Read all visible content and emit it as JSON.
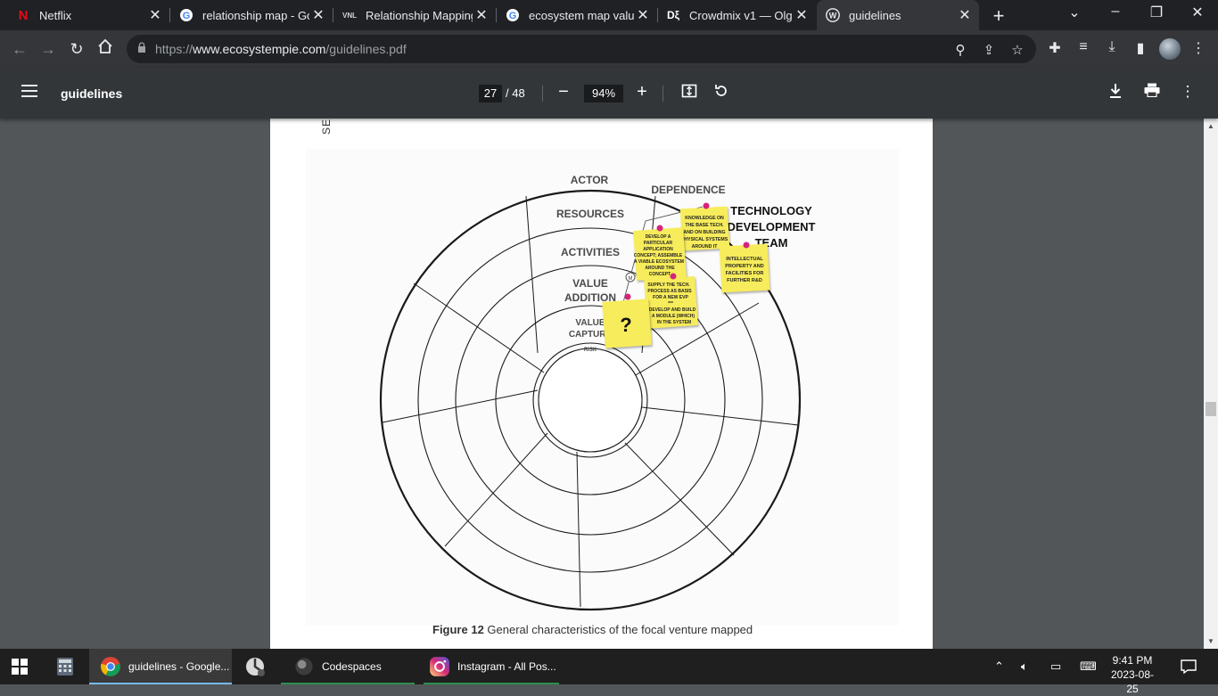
{
  "browser": {
    "tabs": [
      {
        "title": "Netflix",
        "icon": "netflix-icon"
      },
      {
        "title": "relationship map - Goo",
        "icon": "google-icon"
      },
      {
        "title": "Relationship Mapping",
        "icon": "vnl-icon"
      },
      {
        "title": "ecosystem map value",
        "icon": "google-icon"
      },
      {
        "title": "Crowdmix v1 — Olga",
        "icon": "crowdmix-icon"
      },
      {
        "title": "guidelines",
        "icon": "wordpress-icon",
        "active": true
      }
    ],
    "url_prefix": "https://",
    "url_domain": "www.ecosystempie.com",
    "url_path": "/guidelines.pdf"
  },
  "pdf": {
    "title": "guidelines",
    "current_page": "27",
    "total_pages": "/ 48",
    "zoom": "94%"
  },
  "document": {
    "side_text": "SE",
    "caption_bold": "Figure 12",
    "caption_rest": "General characteristics of the focal venture mapped",
    "diagram": {
      "layer_labels": [
        "ACTOR",
        "DEPENDENCE",
        "RESOURCES",
        "ACTIVITIES",
        "VALUE",
        "ADDITION",
        "VALUE",
        "CAPTURE",
        "RISK"
      ],
      "actor_title": [
        "TECHNOLOGY",
        "DEVELOPMENT",
        "TEAM"
      ],
      "markers": [
        "L",
        "M",
        "H"
      ],
      "notes": {
        "knowledge": [
          "KNOWLEDGE ON",
          "THE BASE TECH.",
          "AND ON BUILDING",
          "PHYSICAL SYSTEMS",
          "AROUND IT"
        ],
        "develop": [
          "DEVELOP A",
          "PARTICULAR",
          "APPLICATION",
          "CONCEPT; ASSEMBLE",
          "A VIABLE ECOSYSTEM",
          "AROUND THE",
          "CONCEPT"
        ],
        "intellectual": [
          "INTELLECTUAL",
          "PROPERTY AND",
          "FACILITIES FOR",
          "FURTHER R&D"
        ],
        "supply": [
          "SUPPLY THE TECH.",
          "PROCESS AS BASIS",
          "FOR A NEW EVP",
          "***",
          "DEVELOP AND BUILD",
          "A MODULE (WHICH)",
          "IN THE SYSTEM"
        ],
        "question": "?"
      }
    }
  },
  "taskbar": {
    "items": [
      {
        "label": "guidelines - Google..."
      },
      {
        "label": "Codespaces"
      },
      {
        "label": "Instagram - All Pos..."
      }
    ],
    "time": "9:41 PM",
    "date": "2023-08-25"
  },
  "colors": {
    "tab_bg": "#202124",
    "active_tab": "#35363a",
    "pdf_toolbar": "#323639",
    "viewer_bg": "#525659",
    "sticky_note": "#f7ec5b",
    "pin": "#d6247d"
  }
}
